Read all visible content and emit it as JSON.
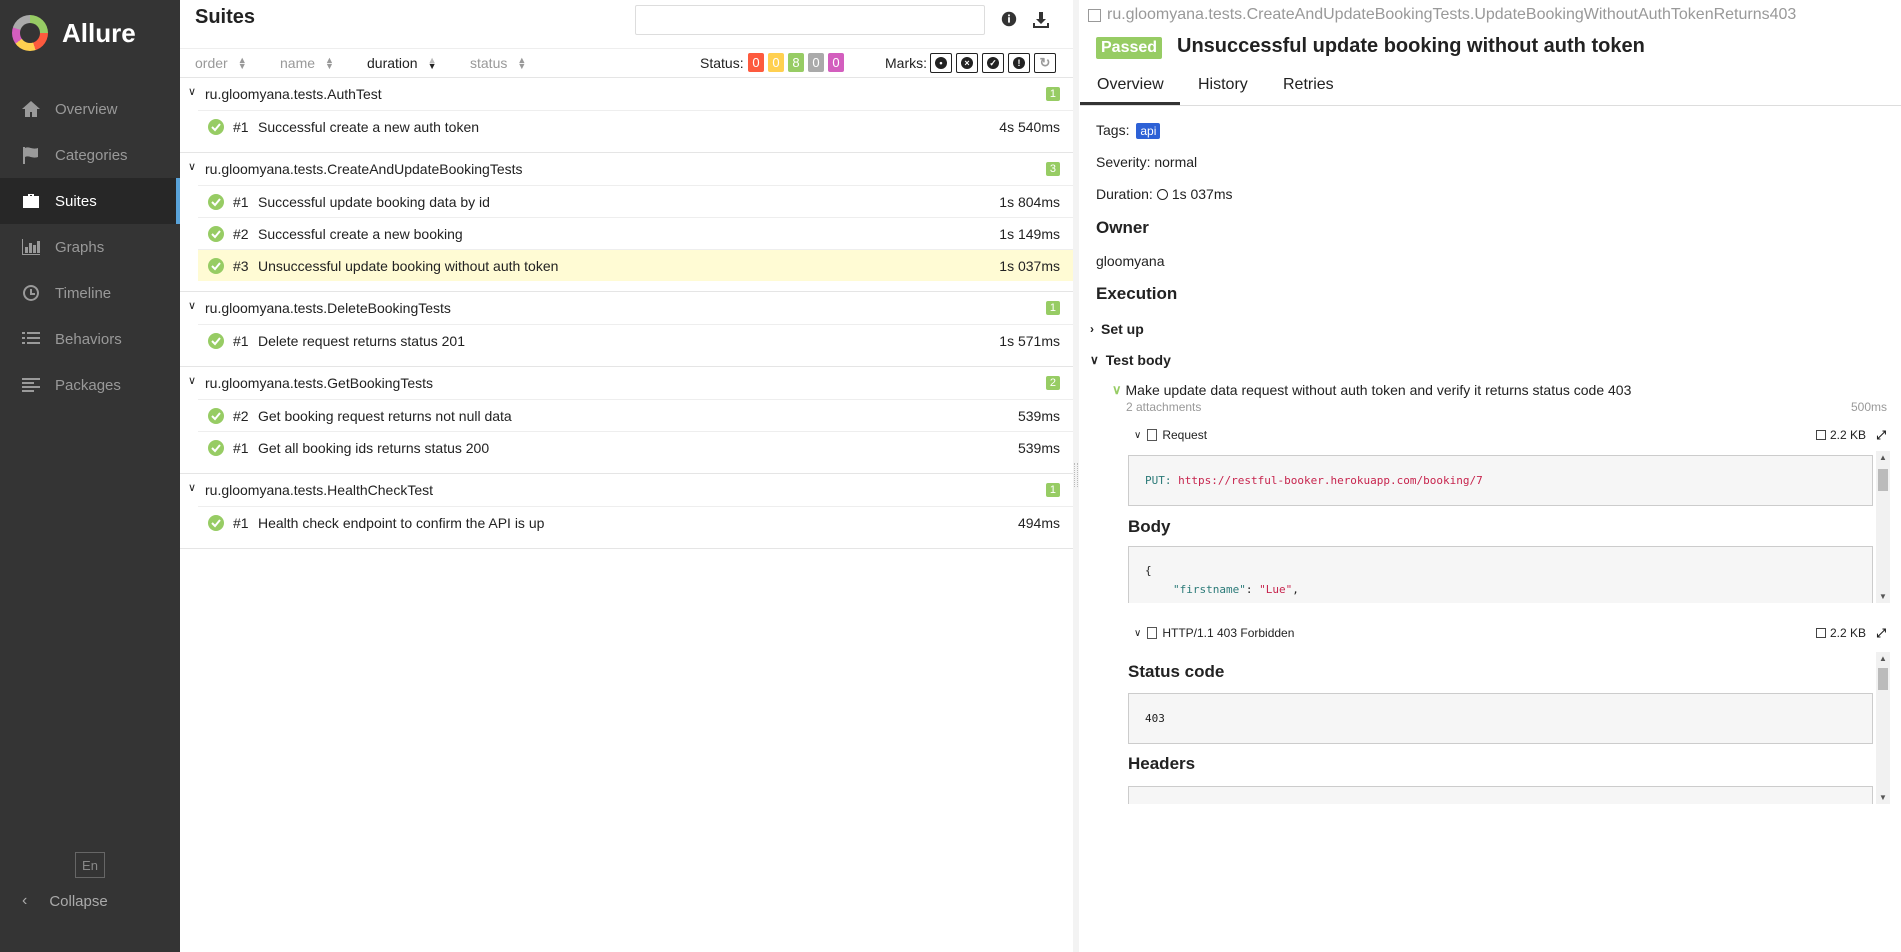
{
  "app": {
    "name": "Allure"
  },
  "sidebar": {
    "items": [
      {
        "label": "Overview",
        "icon": "home-icon"
      },
      {
        "label": "Categories",
        "icon": "flag-icon"
      },
      {
        "label": "Suites",
        "icon": "briefcase-icon",
        "active": true
      },
      {
        "label": "Graphs",
        "icon": "bar-chart-icon"
      },
      {
        "label": "Timeline",
        "icon": "clock-icon"
      },
      {
        "label": "Behaviors",
        "icon": "list-icon"
      },
      {
        "label": "Packages",
        "icon": "align-left-icon"
      }
    ],
    "language": "En",
    "collapse": "Collapse"
  },
  "suites": {
    "title": "Suites",
    "search_placeholder": "",
    "sort": {
      "order": "order",
      "name": "name",
      "duration": "duration",
      "status": "status"
    },
    "status_label": "Status:",
    "status_counts": [
      {
        "value": "0",
        "color": "#fd5a3e"
      },
      {
        "value": "0",
        "color": "#ffd050"
      },
      {
        "value": "8",
        "color": "#97cc64"
      },
      {
        "value": "0",
        "color": "#aaaaaa"
      },
      {
        "value": "0",
        "color": "#d35ebe"
      }
    ],
    "marks_label": "Marks:",
    "groups": [
      {
        "name": "ru.gloomyana.tests.AuthTest",
        "count": "1",
        "tests": [
          {
            "num": "#1",
            "name": "Successful create a new auth token",
            "duration": "4s 540ms"
          }
        ]
      },
      {
        "name": "ru.gloomyana.tests.CreateAndUpdateBookingTests",
        "count": "3",
        "tests": [
          {
            "num": "#1",
            "name": "Successful update booking data by id",
            "duration": "1s 804ms"
          },
          {
            "num": "#2",
            "name": "Successful create a new booking",
            "duration": "1s 149ms"
          },
          {
            "num": "#3",
            "name": "Unsuccessful update booking without auth token",
            "duration": "1s 037ms",
            "selected": true
          }
        ]
      },
      {
        "name": "ru.gloomyana.tests.DeleteBookingTests",
        "count": "1",
        "tests": [
          {
            "num": "#1",
            "name": "Delete request returns status 201",
            "duration": "1s 571ms"
          }
        ]
      },
      {
        "name": "ru.gloomyana.tests.GetBookingTests",
        "count": "2",
        "tests": [
          {
            "num": "#2",
            "name": "Get booking request returns not null data",
            "duration": "539ms"
          },
          {
            "num": "#1",
            "name": "Get all booking ids returns status 200",
            "duration": "539ms"
          }
        ]
      },
      {
        "name": "ru.gloomyana.tests.HealthCheckTest",
        "count": "1",
        "tests": [
          {
            "num": "#1",
            "name": "Health check endpoint to confirm the API is up",
            "duration": "494ms"
          }
        ]
      }
    ]
  },
  "detail": {
    "full_name": "ru.gloomyana.tests.CreateAndUpdateBookingTests.UpdateBookingWithoutAuthTokenReturns403",
    "status": "Passed",
    "title": "Unsuccessful update booking without auth token",
    "tabs": [
      "Overview",
      "History",
      "Retries"
    ],
    "tags_label": "Tags:",
    "tag": "api",
    "severity": "Severity: normal",
    "duration_label": "Duration:",
    "duration": "1s 037ms",
    "owner_heading": "Owner",
    "owner": "gloomyana",
    "execution_heading": "Execution",
    "setup": "Set up",
    "test_body": "Test body",
    "step": "Make update data request without auth token and verify it returns status code 403",
    "attachments_count": "2 attachments",
    "step_duration": "500ms",
    "attachments": [
      {
        "name": "Request",
        "size": "2.2 KB"
      },
      {
        "name": "HTTP/1.1 403 Forbidden",
        "size": "2.2 KB"
      }
    ],
    "request": {
      "method": "PUT:",
      "url": "https://restful-booker.herokuapp.com/booking/7",
      "body_heading": "Body",
      "body_open": "{",
      "body_key": "\"firstname\"",
      "body_colon": ":",
      "body_value": "\"Lue\"",
      "body_comma": ","
    },
    "response": {
      "status_heading": "Status code",
      "status_code": "403",
      "headers_heading": "Headers"
    }
  }
}
